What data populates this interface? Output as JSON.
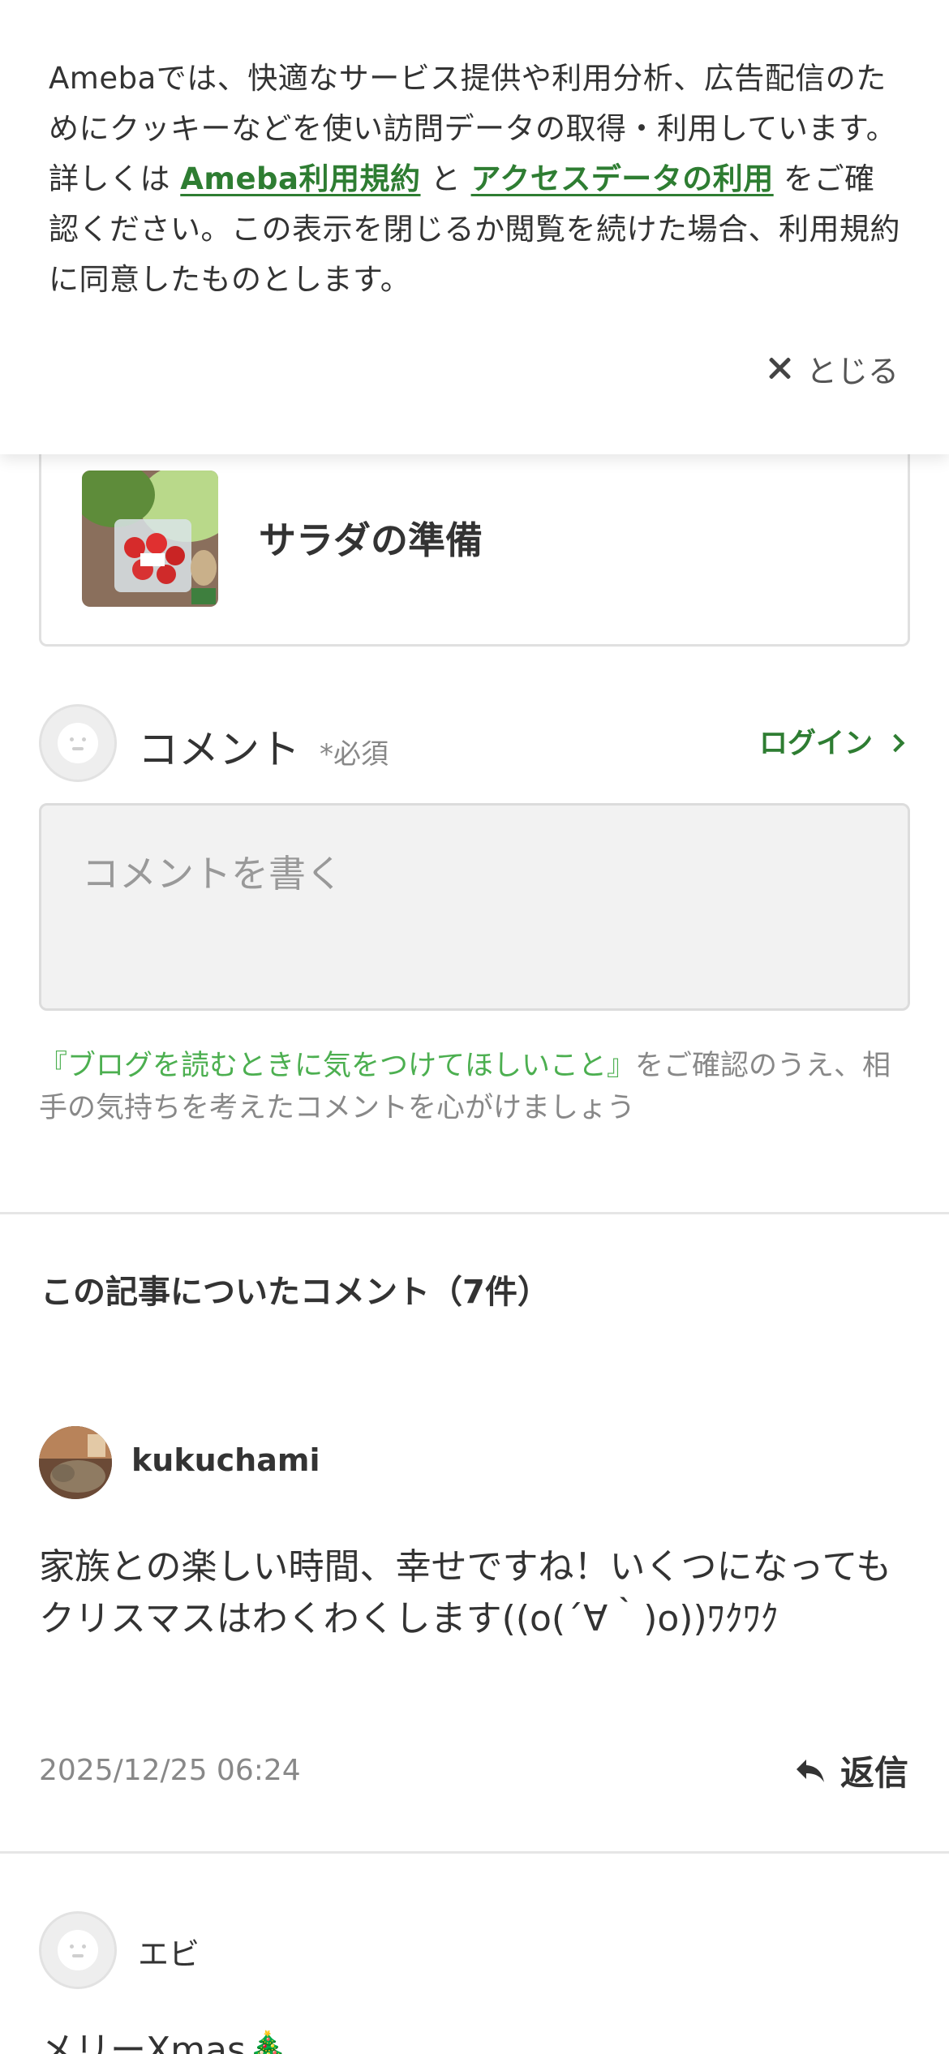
{
  "cookie_banner": {
    "text_part1": "Amebaでは、快適なサービス提供や利用分析、広告配信のためにクッキーなどを使い訪問データの取得・利用しています。詳しくは ",
    "link_terms": "Ameba利用規約",
    "text_part2": " と ",
    "link_access": "アクセスデータの利用",
    "text_part3": " をご確認ください。この表示を閉じるか閲覧を続けた場合、利用規約に同意したものとします。",
    "close_label": "とじる"
  },
  "article_card": {
    "title": "サラダの準備"
  },
  "comment_form": {
    "heading": "コメント",
    "required": "*必須",
    "login_label": "ログイン",
    "placeholder": "コメントを書く",
    "guideline_link": "『ブログを読むときに気をつけてほしいこと』",
    "guideline_text": "をご確認のうえ、相手の気持ちを考えたコメントを心がけましょう"
  },
  "comments_section": {
    "title": "この記事についたコメント（7件）",
    "comments": [
      {
        "username": "kukuchami",
        "body": "家族との楽しい時間、幸せですね！いくつになってもクリスマスはわくわくします((o(´∀｀)o))ﾜｸﾜｸ",
        "timestamp": "2025/12/25 06:24",
        "reply_label": "返信"
      },
      {
        "username": "エビ",
        "body": "メリーXmas🎄"
      }
    ]
  },
  "colors": {
    "accent_green": "#2e7d32",
    "link_green": "#4caf50",
    "text_dark": "#333333",
    "text_muted": "#888888"
  }
}
